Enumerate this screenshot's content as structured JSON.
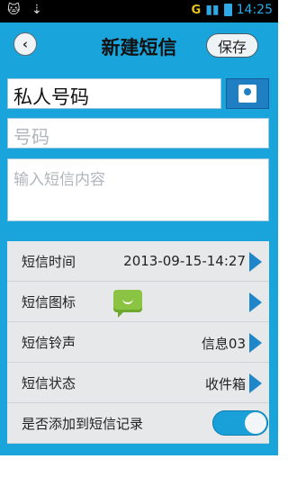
{
  "status_bar": {
    "left_icons": "🐱 ⇣",
    "network": "G",
    "time": "14:25"
  },
  "titlebar": {
    "title": "新建短信",
    "save_label": "保存"
  },
  "form": {
    "name_value": "私人号码",
    "number_placeholder": "号码",
    "content_placeholder": "输入短信内容"
  },
  "settings": {
    "rows": [
      {
        "label": "短信时间",
        "value": "2013-09-15-14:27"
      },
      {
        "label": "短信图标",
        "value": ""
      },
      {
        "label": "短信铃声",
        "value": "信息03"
      },
      {
        "label": "短信状态",
        "value": "收件箱"
      },
      {
        "label": "是否添加到短信记录",
        "toggle": true
      }
    ]
  },
  "colors": {
    "accent": "#19a5dc",
    "arrow": "#1f86c9"
  }
}
